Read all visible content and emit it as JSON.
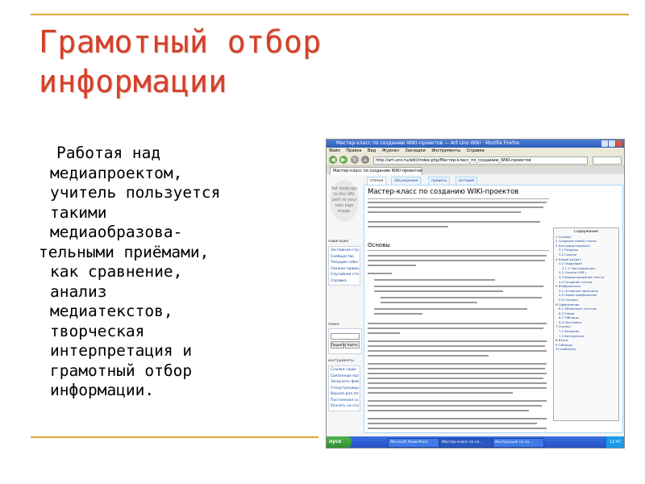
{
  "slide": {
    "title_line1": "Грамотный отбор",
    "title_line2": "информации",
    "body_lines": [
      "Работая над",
      "медиапроектом,",
      "учитель пользуется",
      "такими",
      "медиаобразова-",
      "тельными приёмами,",
      "как сравнение,",
      "анализ",
      "медиатекстов,",
      "творческая",
      "интерпретация и",
      "грамотный отбор",
      "информации."
    ]
  },
  "screenshot": {
    "window_title": "Мастер-класс по созданию WIKI-проектов — Art Uno Wiki · Mozilla Firefox",
    "menu": [
      "Файл",
      "Правка",
      "Вид",
      "Журнал",
      "Закладки",
      "Инструменты",
      "Справка"
    ],
    "url": "http://art.uno.ru/wiki/index.php/Мастер-класс_по_созданию_WIKI-проектов",
    "tab_label": "Мастер-класс по созданию WIKI-проектов",
    "logo_text": [
      "Set $wgLogo",
      "to the URL",
      "path to your",
      "own logo",
      "image."
    ],
    "page_tabs": [
      "статья",
      "обсуждение",
      "править",
      "история"
    ],
    "article_title": "Мастер-класс по созданию WIKI-проектов",
    "section_title": "Основы",
    "toc_heading": "Содержание",
    "toc_items": [
      "1 Основы",
      "2 Создание новой статьи",
      "3 Как редактировать",
      "3.1 Разделы",
      "3.2 Ссылки",
      "4 Новый раздел",
      "4.1 Подраздел",
      "4.1.1 Под-подраздел",
      "4.2 Ссылки (URL)",
      "4.3 Форматирование текста",
      "4.4 Создание статьи",
      "5 Изображения",
      "5.1 Основные принципы",
      "5.2 Новое изображение",
      "5.3 Галерея",
      "6 Оформление",
      "6.1 Обтекание текстом",
      "6.2 Рамка",
      "6.3 Таблицы",
      "6.4 Заголовки",
      "7 Ссылки",
      "7.1 Внешние",
      "7.2 Внутренние",
      "8 Итоги",
      "9 Таблицы",
      "10 Шаблоны"
    ],
    "sidebar_nav_heading": "навигация",
    "sidebar_nav": [
      "Заглавная страница",
      "Сообщество",
      "Текущие события",
      "Свежие правки",
      "Случайная статья",
      "Справка"
    ],
    "sidebar_search_heading": "поиск",
    "search_buttons": [
      "Перейти",
      "Найти"
    ],
    "sidebar_tools_heading": "инструменты",
    "sidebar_tools": [
      "Ссылки сюда",
      "Связанные правки",
      "Загрузить файл",
      "Спецстраницы",
      "Версия для печати",
      "Постоянная ссылка",
      "Указать на статью"
    ],
    "taskbar": {
      "start": "пуск",
      "items": [
        "Microsoft PowerPoint",
        "Мастер-класс по со...",
        "Инструкция по со..."
      ],
      "clock": "12:47"
    }
  }
}
